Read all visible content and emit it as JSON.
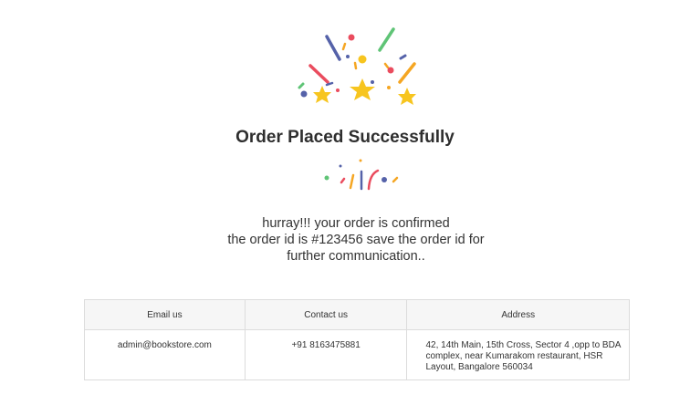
{
  "page": {
    "title": "Order Placed Successfully",
    "message_lines": [
      "hurray!!! your order is confirmed",
      "the order id is #123456 save the order id for",
      "further communication.."
    ]
  },
  "contact_table": {
    "headers": [
      "Email us",
      "Contact us",
      "Address"
    ],
    "row": {
      "email": "admin@bookstore.com",
      "phone": "+91 8163475881",
      "address": "42, 14th Main, 15th Cross, Sector 4 ,opp to BDA complex, near Kumarakom restaurant, HSR Layout, Bangalore 560034"
    }
  },
  "colors": {
    "star": "#f7c51f",
    "red": "#ea4c5e",
    "blue": "#5562a9",
    "green": "#5fc476",
    "orange": "#f5a623"
  },
  "icons": [
    "celebration-confetti-icon",
    "confetti-burst-icon"
  ]
}
